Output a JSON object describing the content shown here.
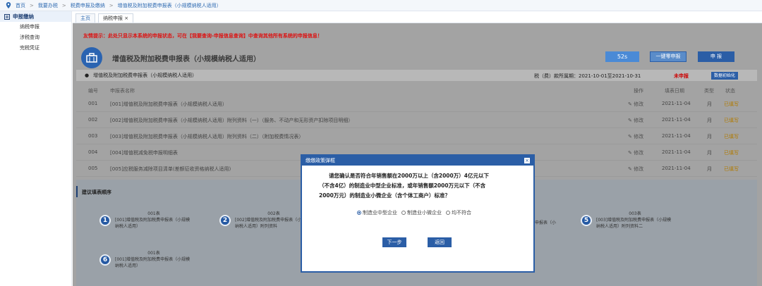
{
  "breadcrumb": {
    "items": [
      "首页",
      "我要办税",
      "税费申报及缴纳",
      "增值税及附加税费申报表（小规模纳税人适用）"
    ]
  },
  "sidebar": {
    "header": "申报缴纳",
    "items": [
      {
        "label": "纳税申报"
      },
      {
        "label": "涉税查询"
      },
      {
        "label": "完税凭证"
      }
    ]
  },
  "tabs": [
    {
      "label": "主页"
    },
    {
      "label": "纳税申报 ×"
    }
  ],
  "notice": "友情提示：此处只显示本系统的申报状态，可在【我要查询-申报信息查询】中查询其他所有系统的申报信息！",
  "form": {
    "title": "增值税及附加税费申报表（小规模纳税人适用）",
    "timer": "52s",
    "zero_label": "一键零申报",
    "submit_label": "申 报",
    "subhead": "增值税及附加税费申报表（小规模纳税人适用）",
    "period": "税（费）款所属期：2021-10-01至2021-10-31",
    "status": "未申报",
    "init_label": "数据初始化"
  },
  "table": {
    "headers": {
      "no": "编号",
      "name": "申报表名称",
      "op": "操作",
      "date": "填表日期",
      "type": "类型",
      "status": "状态"
    },
    "rows": [
      {
        "no": "001",
        "name": "[001]增值税及附加税费申报表（小规模纳税人适用）",
        "op": "修改",
        "date": "2021-11-04",
        "type": "月",
        "status": "已填写"
      },
      {
        "no": "002",
        "name": "[002]增值税及附加税费申报表（小规模纳税人适用）附列资料（一）（服务、不动产和无形资产扣除项目明细）",
        "op": "修改",
        "date": "2021-11-04",
        "type": "月",
        "status": "已填写"
      },
      {
        "no": "003",
        "name": "[003]增值税及附加税费申报表（小规模纳税人适用）附列资料（二）（附加税费情况表）",
        "op": "修改",
        "date": "2021-11-04",
        "type": "月",
        "status": "已填写"
      },
      {
        "no": "004",
        "name": "[004]增值税减免税申报明细表",
        "op": "修改",
        "date": "2021-11-04",
        "type": "月",
        "status": "已填写"
      },
      {
        "no": "005",
        "name": "[005]应税服务减除项目清单(差额征收资格纳税人适用)",
        "op": "修改",
        "date": "2021-11-04",
        "type": "月",
        "status": "已填写"
      }
    ]
  },
  "order": {
    "title": "建议填表顺序",
    "steps": [
      {
        "num": "1",
        "code": "001表",
        "desc": "[001]增值税及附加税费申报表（小规模纳税人适用）"
      },
      {
        "num": "2",
        "code": "002表",
        "desc": "[002]增值税及附加税费申报表（小规模纳税人适用）附列资料"
      },
      {
        "num": "5",
        "code": "003表",
        "desc": "[003]增值税及附加税费申报表（小规模纳税人适用）附列资料二"
      },
      {
        "num": "6",
        "code": "001表",
        "desc": "[001]增值税及附加税费申报表（小规模纳税人适用）"
      }
    ],
    "partial_text": "申报表（小"
  },
  "modal": {
    "title": "缴缴政策弹框",
    "close": "×",
    "question_lines": [
      "请您确认是否符合年销售额在2000万以上（含2000万）4亿元以下",
      "（不含4亿）的制造业中型企业标准，或年销售额2000万元以下（不含",
      "2000万元）的制造业小微企业（含个体工商户）标准？"
    ],
    "options": [
      {
        "label": "制造业中型企业",
        "selected": true
      },
      {
        "label": "制造业小微企业",
        "selected": false
      },
      {
        "label": "均不符合",
        "selected": false
      }
    ],
    "next_label": "下一步",
    "back_label": "返回"
  }
}
